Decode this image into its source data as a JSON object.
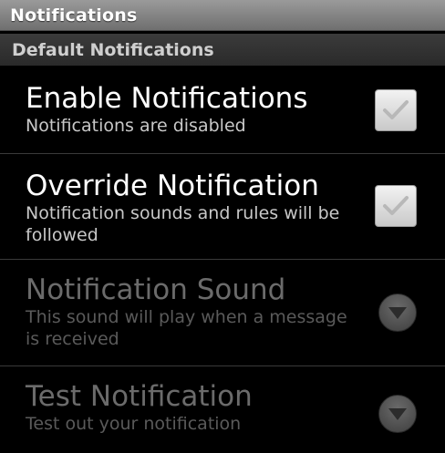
{
  "header": {
    "title": "Notifications"
  },
  "section": {
    "label": "Default Notifications"
  },
  "prefs": {
    "enable": {
      "title": "Enable Notifications",
      "summary": "Notifications are disabled",
      "checked": false
    },
    "override": {
      "title": "Override Notification",
      "summary": "Notification sounds and rules will be followed",
      "checked": false
    },
    "sound": {
      "title": "Notification Sound",
      "summary": "This sound will play when a message is received"
    },
    "test": {
      "title": "Test Notification",
      "summary": "Test out your notification"
    }
  },
  "colors": {
    "background": "#000000",
    "title_bar": "#8a8a8a",
    "section_header": "#333333",
    "text_primary": "#ffffff",
    "text_disabled": "#6b6b6b"
  },
  "icons": {
    "checkbox": "check-icon",
    "dropdown": "arrow-down-icon"
  }
}
